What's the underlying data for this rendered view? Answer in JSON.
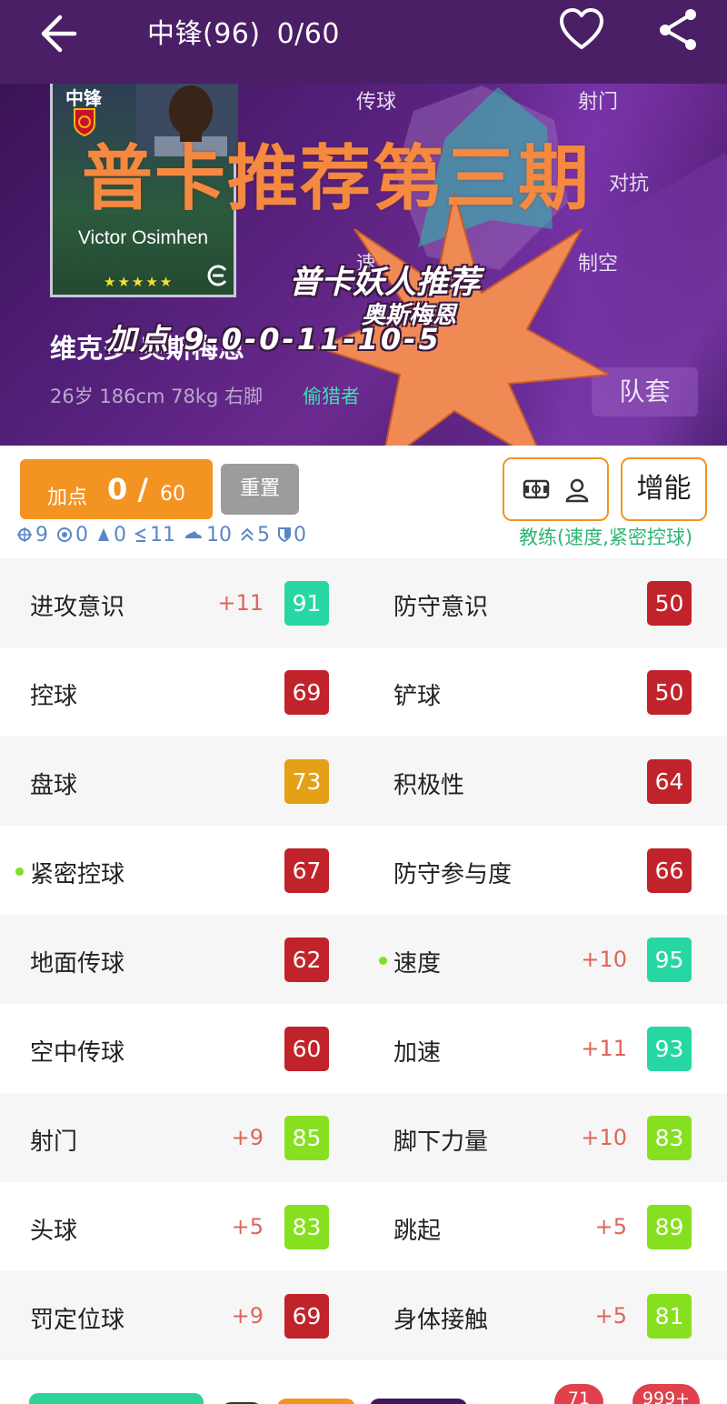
{
  "header": {
    "title": "中锋(96)",
    "progress": "0/60"
  },
  "hero": {
    "card_position": "中锋",
    "card_name": "Victor Osimhen",
    "card_stars": "★★★★★",
    "radar_labels": {
      "pass": "传球",
      "shoot": "射门",
      "physical": "对抗",
      "speed": "速度",
      "air": "制空"
    },
    "player_name": "维克多·奥斯梅恩",
    "player_meta": "26岁 186cm 78kg 右脚",
    "play_style": "偷猎者",
    "kit_button": "队套"
  },
  "overlay": {
    "title": "普卡推荐第三期",
    "line1": "普卡妖人推荐",
    "line2": "奥斯梅恩",
    "line3": "加点 9-0-0-11-10-5"
  },
  "controls": {
    "add_label": "加点",
    "add_value": "0",
    "add_sep": "/",
    "add_max": "60",
    "reset": "重置",
    "boost": "增能",
    "coach": "教练(速度,紧密控球)",
    "skills": [
      "9",
      "0",
      "0",
      "11",
      "10",
      "5",
      "0"
    ]
  },
  "stats": [
    [
      {
        "name": "进攻意识",
        "boost": "+11",
        "value": "91",
        "color": "#27d7a3",
        "dot": false
      },
      {
        "name": "防守意识",
        "boost": "",
        "value": "50",
        "color": "#c1232b",
        "dot": false
      }
    ],
    [
      {
        "name": "控球",
        "boost": "",
        "value": "69",
        "color": "#c1232b",
        "dot": false
      },
      {
        "name": "铲球",
        "boost": "",
        "value": "50",
        "color": "#c1232b",
        "dot": false
      }
    ],
    [
      {
        "name": "盘球",
        "boost": "",
        "value": "73",
        "color": "#e4a017",
        "dot": false
      },
      {
        "name": "积极性",
        "boost": "",
        "value": "64",
        "color": "#c1232b",
        "dot": false
      }
    ],
    [
      {
        "name": "紧密控球",
        "boost": "",
        "value": "67",
        "color": "#c1232b",
        "dot": true
      },
      {
        "name": "防守参与度",
        "boost": "",
        "value": "66",
        "color": "#c1232b",
        "dot": false
      }
    ],
    [
      {
        "name": "地面传球",
        "boost": "",
        "value": "62",
        "color": "#c1232b",
        "dot": false
      },
      {
        "name": "速度",
        "boost": "+10",
        "value": "95",
        "color": "#27d7a3",
        "dot": true
      }
    ],
    [
      {
        "name": "空中传球",
        "boost": "",
        "value": "60",
        "color": "#c1232b",
        "dot": false
      },
      {
        "name": "加速",
        "boost": "+11",
        "value": "93",
        "color": "#27d7a3",
        "dot": false
      }
    ],
    [
      {
        "name": "射门",
        "boost": "+9",
        "value": "85",
        "color": "#86e01f",
        "dot": false
      },
      {
        "name": "脚下力量",
        "boost": "+10",
        "value": "83",
        "color": "#86e01f",
        "dot": false
      }
    ],
    [
      {
        "name": "头球",
        "boost": "+5",
        "value": "83",
        "color": "#86e01f",
        "dot": false
      },
      {
        "name": "跳起",
        "boost": "+5",
        "value": "89",
        "color": "#86e01f",
        "dot": false
      }
    ],
    [
      {
        "name": "罚定位球",
        "boost": "+9",
        "value": "69",
        "color": "#c1232b",
        "dot": false
      },
      {
        "name": "身体接触",
        "boost": "+5",
        "value": "81",
        "color": "#86e01f",
        "dot": false
      }
    ]
  ],
  "bottom": {
    "badge1": "71",
    "badge2": "999+"
  }
}
